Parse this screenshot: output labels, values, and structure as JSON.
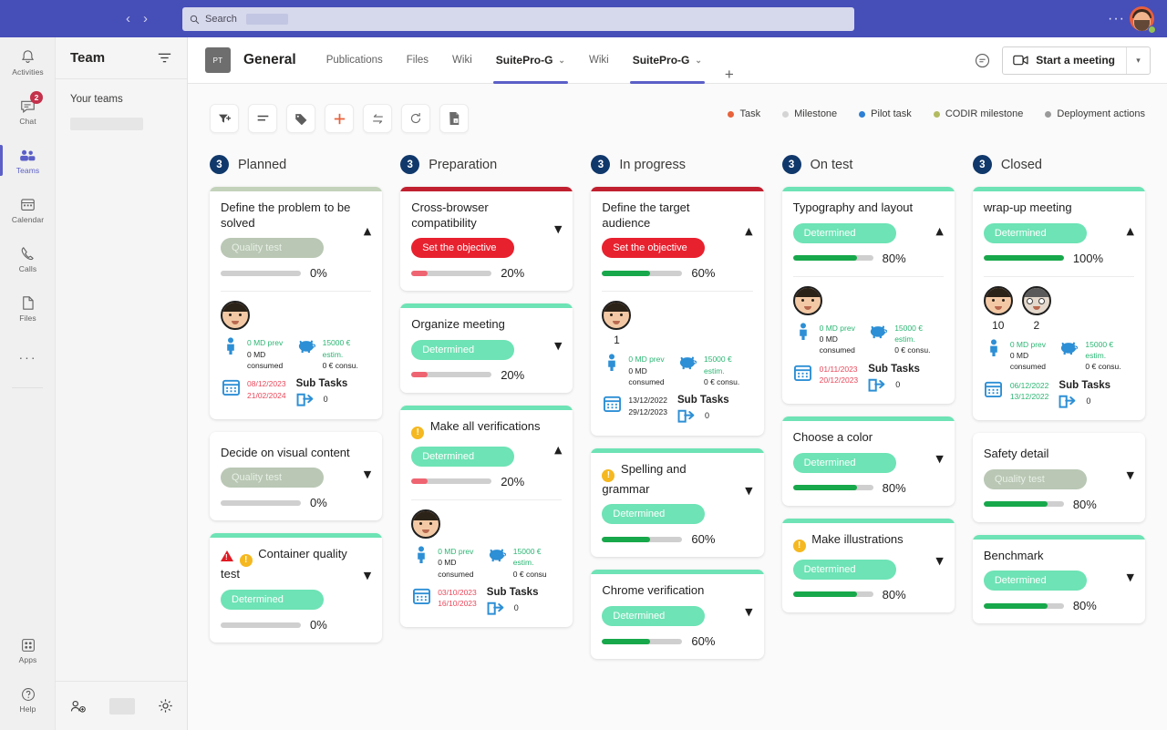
{
  "topbar": {
    "search_placeholder": "Search",
    "back_icon": "chevron-left-icon",
    "forward_icon": "chevron-right-icon",
    "more_label": "···"
  },
  "rail": {
    "items": [
      {
        "label": "Activities",
        "icon": "bell-icon",
        "badge": null,
        "active": false
      },
      {
        "label": "Chat",
        "icon": "chat-icon",
        "badge": "2",
        "active": false
      },
      {
        "label": "Teams",
        "icon": "teams-icon",
        "badge": null,
        "active": true
      },
      {
        "label": "Calendar",
        "icon": "calendar-icon",
        "badge": null,
        "active": false
      },
      {
        "label": "Calls",
        "icon": "phone-icon",
        "badge": null,
        "active": false
      },
      {
        "label": "Files",
        "icon": "file-icon",
        "badge": null,
        "active": false
      }
    ],
    "more_label": "···",
    "bottom": [
      {
        "label": "Apps",
        "icon": "apps-icon"
      },
      {
        "label": "Help",
        "icon": "help-icon"
      }
    ]
  },
  "teams_panel": {
    "title": "Team",
    "filter_icon": "filter-lines-icon",
    "section_label": "Your teams",
    "join_icon": "join-team-icon",
    "settings_icon": "gear-icon"
  },
  "channel": {
    "avatar_initials": "PT",
    "name": "General",
    "tabs": [
      {
        "label": "Publications",
        "bold": false,
        "selected": false,
        "caret": false
      },
      {
        "label": "Files",
        "bold": false,
        "selected": false,
        "caret": false
      },
      {
        "label": "Wiki",
        "bold": false,
        "selected": false,
        "caret": false
      },
      {
        "label": "SuitePro-G",
        "bold": true,
        "selected": true,
        "caret": true
      },
      {
        "label": "Wiki",
        "bold": false,
        "selected": false,
        "caret": false
      },
      {
        "label": "SuitePro-G",
        "bold": true,
        "selected": true,
        "caret": true
      }
    ],
    "add_tab_label": "+",
    "chat_icon": "conversation-icon",
    "meeting_label": "Start a meeting",
    "meeting_icon": "camera-icon",
    "meeting_caret": "chevron-down-icon"
  },
  "toolbar": {
    "buttons": [
      {
        "name": "filter-add-button",
        "glyph": "filter-plus-icon"
      },
      {
        "name": "sort-button",
        "glyph": "lines-icon"
      },
      {
        "name": "tag-button",
        "glyph": "tag-icon"
      },
      {
        "name": "add-button",
        "glyph": "plus-icon"
      },
      {
        "name": "swap-button",
        "glyph": "swap-arrows-icon"
      },
      {
        "name": "refresh-button",
        "glyph": "refresh-icon"
      },
      {
        "name": "export-excel-button",
        "glyph": "excel-file-icon"
      }
    ]
  },
  "legend": [
    {
      "label": "Task",
      "color": "#e8623a"
    },
    {
      "label": "Milestone",
      "color": "#d4d4d4"
    },
    {
      "label": "Pilot task",
      "color": "#2d7fd5"
    },
    {
      "label": "CODIR milestone",
      "color": "#b3bb61"
    },
    {
      "label": "Deployment actions",
      "color": "#9a9a9a"
    }
  ],
  "columns": [
    {
      "count": "3",
      "title": "Planned",
      "cards": [
        {
          "title": "Define the problem to be solved",
          "top_color": "#c3d2bb",
          "chip": {
            "label": "Quality test",
            "style": "grey"
          },
          "progress": {
            "value": 0,
            "label": "0%",
            "color": "#cfcfcf"
          },
          "caret": "▲",
          "expanded": true,
          "avatars": [
            {
              "type": "man"
            }
          ],
          "avatar_numbers": [],
          "stats": {
            "md_prev": "0 MD prev",
            "md_consumed": "0 MD consumed",
            "budget_estim": "15000 € estim.",
            "budget_consu": "0 € consu.",
            "date_start": "08/12/2023",
            "date_end": "21/02/2024",
            "date_color": "red",
            "md_prev_color": "green",
            "subtasks_label": "Sub Tasks",
            "subtasks_count": "0"
          }
        },
        {
          "title": "Decide on visual content",
          "top_color": "#ffffff",
          "chip": {
            "label": "Quality test",
            "style": "grey"
          },
          "progress": {
            "value": 0,
            "label": "0%",
            "color": "#cfcfcf"
          },
          "caret": "▼",
          "expanded": false
        },
        {
          "title": "Container quality test",
          "icons": [
            "warning-triangle-icon",
            "exclamation-circle-icon"
          ],
          "top_color": "#6ee3b5",
          "chip": {
            "label": "Determined",
            "style": "green"
          },
          "progress": {
            "value": 0,
            "label": "0%",
            "color": "#cfcfcf"
          },
          "caret": "▼",
          "expanded": false
        }
      ]
    },
    {
      "count": "3",
      "title": "Preparation",
      "cards": [
        {
          "title": "Cross-browser compatibility",
          "top_color": "#c0202f",
          "chip": {
            "label": "Set the objective",
            "style": "red"
          },
          "progress": {
            "value": 20,
            "label": "20%",
            "color": "#ef6471"
          },
          "caret": "▼",
          "expanded": false
        },
        {
          "title": "Organize meeting",
          "top_color": "#6ee3b5",
          "chip": {
            "label": "Determined",
            "style": "green"
          },
          "progress": {
            "value": 20,
            "label": "20%",
            "color": "#ef6471"
          },
          "caret": "▼",
          "expanded": false
        },
        {
          "title": "Make all verifications",
          "icons": [
            "exclamation-circle-icon"
          ],
          "top_color": "#6ee3b5",
          "chip": {
            "label": "Determined",
            "style": "green"
          },
          "progress": {
            "value": 20,
            "label": "20%",
            "color": "#ef6471"
          },
          "caret": "▲",
          "expanded": true,
          "avatars": [
            {
              "type": "man"
            }
          ],
          "avatar_numbers": [],
          "stats": {
            "md_prev": "0 MD prev",
            "md_consumed": "0 MD consumed",
            "budget_estim": "15000 € estim.",
            "budget_consu": "0 € consu",
            "date_start": "03/10/2023",
            "date_end": "16/10/2023",
            "date_color": "red",
            "md_prev_color": "green",
            "subtasks_label": "Sub Tasks",
            "subtasks_count": "0"
          }
        }
      ]
    },
    {
      "count": "3",
      "title": "In progress",
      "cards": [
        {
          "title": "Define the target audience",
          "top_color": "#c0202f",
          "chip": {
            "label": "Set the objective",
            "style": "red"
          },
          "progress": {
            "value": 60,
            "label": "60%",
            "color": "#17a84b"
          },
          "caret": "▲",
          "expanded": true,
          "avatars": [
            {
              "type": "man"
            }
          ],
          "avatar_numbers": [
            "1"
          ],
          "stats": {
            "md_prev": "0 MD prev",
            "md_consumed": "0 MD consumed",
            "budget_estim": "15000 € estim.",
            "budget_consu": "0 € consu.",
            "date_start": "13/12/2022",
            "date_end": "29/12/2023",
            "date_color": "dark",
            "md_prev_color": "green",
            "subtasks_label": "Sub Tasks",
            "subtasks_count": "0"
          }
        },
        {
          "title": "Spelling and grammar",
          "icons": [
            "exclamation-circle-icon"
          ],
          "top_color": "#6ee3b5",
          "chip": {
            "label": "Determined",
            "style": "green"
          },
          "progress": {
            "value": 60,
            "label": "60%",
            "color": "#17a84b"
          },
          "caret": "▼",
          "expanded": false
        },
        {
          "title": "Chrome verification",
          "top_color": "#6ee3b5",
          "chip": {
            "label": "Determined",
            "style": "green"
          },
          "progress": {
            "value": 60,
            "label": "60%",
            "color": "#17a84b"
          },
          "caret": "▼",
          "expanded": false
        }
      ]
    },
    {
      "count": "3",
      "title": "On test",
      "cards": [
        {
          "title": "Typography and layout",
          "top_color": "#6ee3b5",
          "chip": {
            "label": "Determined",
            "style": "green"
          },
          "progress": {
            "value": 80,
            "label": "80%",
            "color": "#17a84b"
          },
          "caret": "▲",
          "expanded": true,
          "avatars": [
            {
              "type": "man"
            }
          ],
          "avatar_numbers": [],
          "stats": {
            "md_prev": "0 MD prev",
            "md_consumed": "0 MD consumed",
            "budget_estim": "15000 € estim.",
            "budget_consu": "0 € consu.",
            "date_start": "01/11/2023",
            "date_end": "20/12/2023",
            "date_color": "red",
            "md_prev_color": "green",
            "subtasks_label": "Sub Tasks",
            "subtasks_count": "0"
          }
        },
        {
          "title": "Choose a color",
          "top_color": "#6ee3b5",
          "chip": {
            "label": "Determined",
            "style": "green"
          },
          "progress": {
            "value": 80,
            "label": "80%",
            "color": "#17a84b"
          },
          "caret": "▼",
          "expanded": false
        },
        {
          "title": "Make illustrations",
          "icons": [
            "exclamation-circle-icon"
          ],
          "top_color": "#6ee3b5",
          "chip": {
            "label": "Determined",
            "style": "green"
          },
          "progress": {
            "value": 80,
            "label": "80%",
            "color": "#17a84b"
          },
          "caret": "▼",
          "expanded": false
        }
      ]
    },
    {
      "count": "3",
      "title": "Closed",
      "cards": [
        {
          "title": "wrap-up meeting",
          "top_color": "#6ee3b5",
          "chip": {
            "label": "Determined",
            "style": "green"
          },
          "progress": {
            "value": 100,
            "label": "100%",
            "color": "#17a84b"
          },
          "caret": "▲",
          "expanded": true,
          "avatars": [
            {
              "type": "man"
            },
            {
              "type": "glasses"
            }
          ],
          "avatar_numbers": [
            "10",
            "2"
          ],
          "stats": {
            "md_prev": "0 MD prev",
            "md_consumed": "0 MD consumed",
            "budget_estim": "15000 € estim.",
            "budget_consu": "0 € consu.",
            "date_start": "06/12/2022",
            "date_end": "13/12/2022",
            "date_color": "green",
            "md_prev_color": "green",
            "subtasks_label": "Sub Tasks",
            "subtasks_count": "0"
          }
        },
        {
          "title": "Safety detail",
          "top_color": "#ffffff",
          "chip": {
            "label": "Quality test",
            "style": "grey"
          },
          "progress": {
            "value": 80,
            "label": "80%",
            "color": "#17a84b"
          },
          "caret": "▼",
          "expanded": false
        },
        {
          "title": "Benchmark",
          "top_color": "#6ee3b5",
          "chip": {
            "label": "Determined",
            "style": "green"
          },
          "progress": {
            "value": 80,
            "label": "80%",
            "color": "#17a84b"
          },
          "caret": "▼",
          "expanded": false
        }
      ]
    }
  ]
}
